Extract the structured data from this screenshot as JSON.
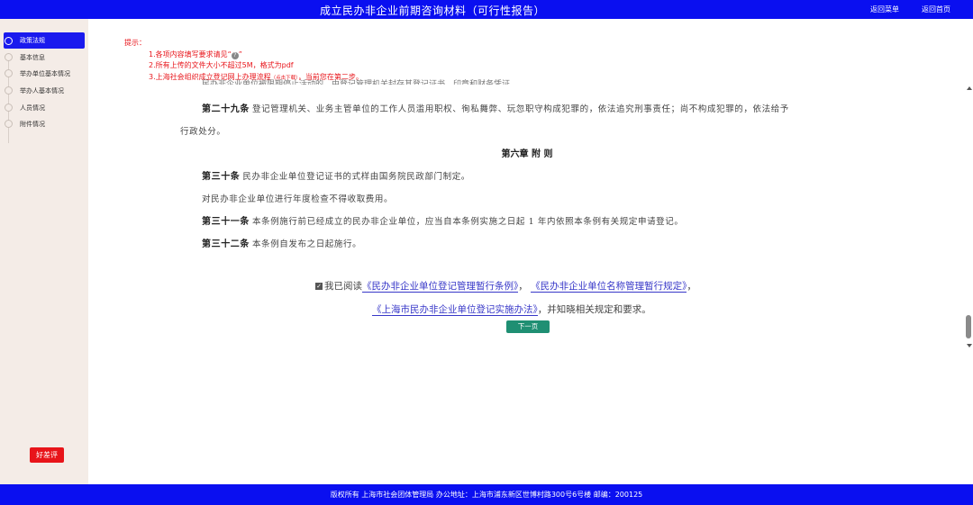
{
  "header": {
    "title": "成立民办非企业前期咨询材料（可行性报告）",
    "back_menu": "返回菜单",
    "back_home": "返回首页"
  },
  "sidebar": {
    "steps": [
      {
        "label": "政策法规",
        "active": true
      },
      {
        "label": "基本信息",
        "active": false
      },
      {
        "label": "举办单位基本情况",
        "active": false
      },
      {
        "label": "举办人基本情况",
        "active": false
      },
      {
        "label": "人员情况",
        "active": false
      },
      {
        "label": "附件情况",
        "active": false
      }
    ],
    "rate_button": "好差评"
  },
  "tips": {
    "title": "提示：",
    "line1": "1.各项内容填写要求请见“",
    "line1_icon": "?",
    "line1_tail": "”",
    "line2": "2.所有上传的文件大小不超过5M，格式为pdf",
    "line3_a": "3.上海社会组织成立登记网上办理流程",
    "line3_small": "（点击下载）",
    "line3_b": "，当前您在第二步。"
  },
  "article": {
    "cutoff_text": "民办非企业单位被限期停止活动的，由登记管理机关封存其登记证书、印章和财务凭证。",
    "art29_title": "第二十九条",
    "art29_text": "登记管理机关、业务主管单位的工作人员滥用职权、徇私舞弊、玩忽职守构成犯罪的，依法追究刑事责任；尚不构成犯罪的，依法给予",
    "art29_cont": "行政处分。",
    "chapter": "第六章 附 则",
    "art30_title": "第三十条",
    "art30_text": "民办非企业单位登记证书的式样由国务院民政部门制定。",
    "art30_extra": "对民办非企业单位进行年度检查不得收取费用。",
    "art31_title": "第三十一条",
    "art31_text": "本条例施行前已经成立的民办非企业单位，应当自本条例实施之日起 1 年内依照本条例有关规定申请登记。",
    "art32_title": "第三十二条",
    "art32_text": "本条例自发布之日起施行。"
  },
  "agree": {
    "prefix": "我已阅读",
    "link1": "《民办非企业单位登记管理暂行条例》",
    "sep1": "，",
    "link2": "《民办非企业单位名称管理暂行规定》",
    "sep2": "，",
    "link3": "《上海市民办非企业单位登记实施办法》",
    "suffix": "，并知晓相关规定和要求。",
    "checked": true
  },
  "next_button": "下一页",
  "footer": {
    "text": "版权所有 上海市社会团体管理局 办公地址：上海市浦东新区世博村路300号6号楼 邮编：200125"
  },
  "colors": {
    "brand_blue": "#0a0ff0",
    "tip_red": "#e8141a",
    "next_green": "#1f8f73",
    "sidebar_bg": "#f4ece7"
  }
}
